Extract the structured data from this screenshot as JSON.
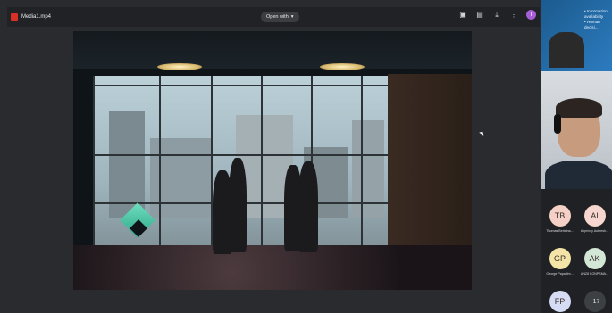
{
  "topbar": {
    "file_name": "Media1.mp4",
    "open_with": "Open with",
    "user_initial": "I"
  },
  "meeting": {
    "slide_text": [
      "• Information",
      "availability",
      "",
      "• Human",
      "decisi..."
    ],
    "participants": [
      {
        "initials": "TB",
        "name": "Thomas Bertaina...",
        "color": "#f4d0c6"
      },
      {
        "initials": "AI",
        "name": "Apprivoy Aubresh...",
        "color": "#f7d6cf"
      },
      {
        "initials": "GP",
        "name": "George Papadim...",
        "color": "#f4e4a8"
      },
      {
        "initials": "AK",
        "name": "ANZ8 KONPSMA...",
        "color": "#d3e7d6"
      },
      {
        "initials": "FP",
        "name": "",
        "color": "#d5dcf3"
      },
      {
        "initials": "+17",
        "name": "",
        "color": "#3c4043"
      }
    ]
  }
}
